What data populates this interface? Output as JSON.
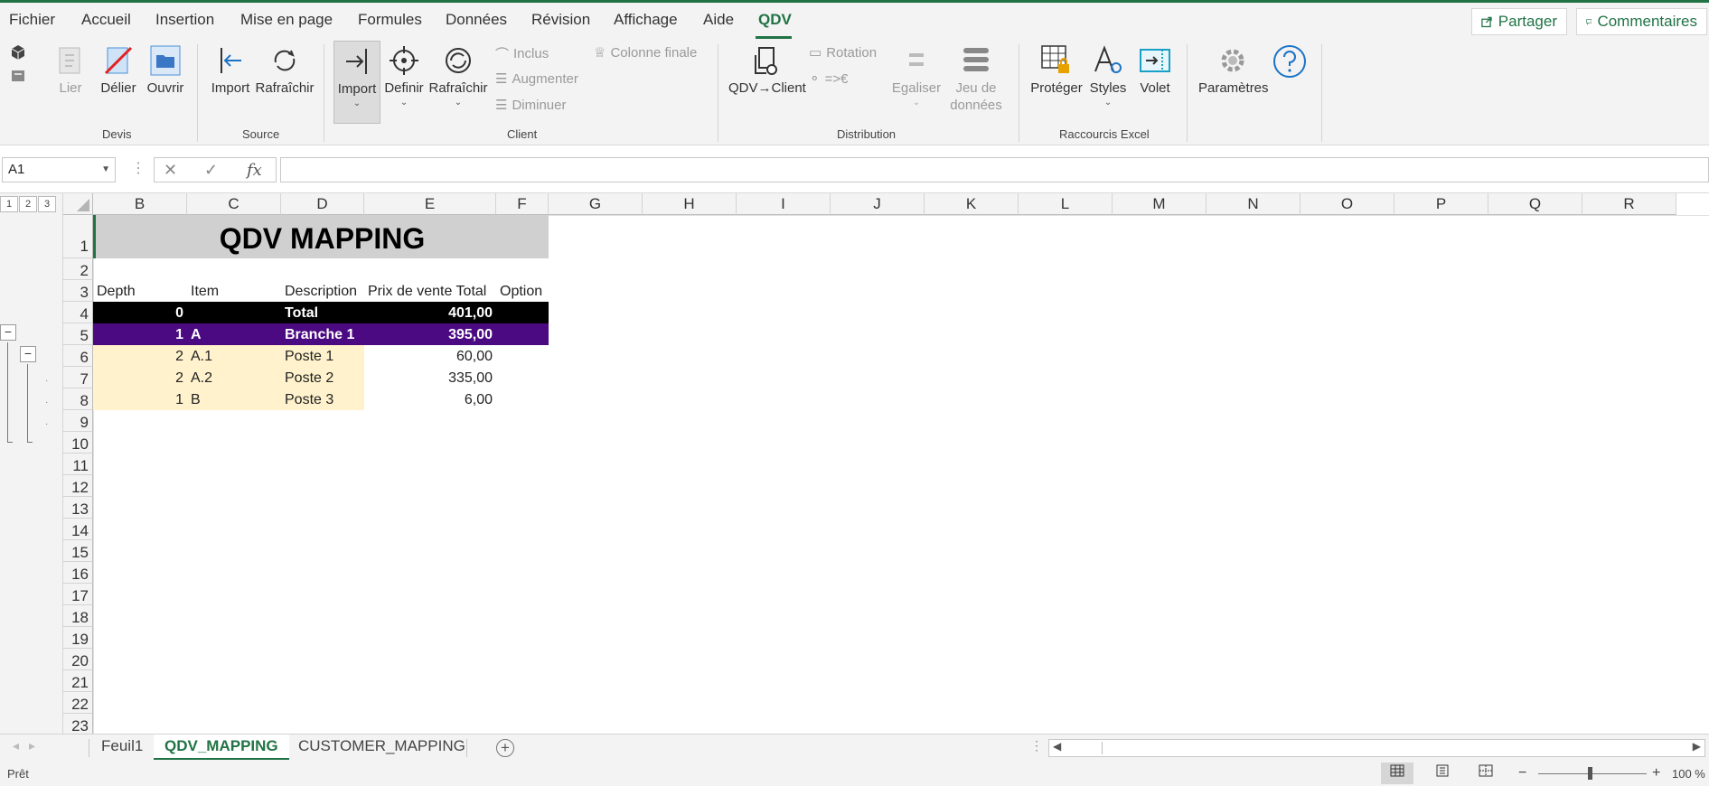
{
  "menu": {
    "items": [
      "Fichier",
      "Accueil",
      "Insertion",
      "Mise en page",
      "Formules",
      "Données",
      "Révision",
      "Affichage",
      "Aide",
      "QDV"
    ],
    "active": "QDV",
    "share_label": "Partager",
    "comments_label": "Commentaires"
  },
  "ribbon": {
    "groups": {
      "devis": {
        "label": "Devis",
        "lier": "Lier",
        "delier": "Délier",
        "ouvrir": "Ouvrir"
      },
      "source": {
        "label": "Source",
        "import": "Import",
        "rafraichir": "Rafraîchir"
      },
      "client": {
        "label": "Client",
        "import": "Import",
        "definir": "Definir",
        "rafraichir": "Rafraîchir",
        "inclus": "Inclus",
        "augmenter": "Augmenter",
        "diminuer": "Diminuer",
        "colonne_finale": "Colonne finale"
      },
      "distribution": {
        "label": "Distribution",
        "qdv_client": "QDV→Client",
        "rotation": "Rotation",
        "euro": "=>€",
        "egaliser": "Egaliser",
        "jeu_line1": "Jeu de",
        "jeu_line2": "données"
      },
      "raccourcis": {
        "label": "Raccourcis Excel",
        "proteger": "Protéger",
        "styles": "Styles",
        "volet": "Volet"
      },
      "parametres": {
        "label": "Paramètres"
      }
    },
    "help_icon": "question-circle-icon"
  },
  "formula_bar": {
    "name_box": "A1",
    "fx": "fx",
    "formula": ""
  },
  "outline": {
    "levels": [
      "1",
      "2",
      "3"
    ]
  },
  "columns": [
    "B",
    "C",
    "D",
    "E",
    "F",
    "G",
    "H",
    "I",
    "J",
    "K",
    "L",
    "M",
    "N",
    "O",
    "P",
    "Q",
    "R"
  ],
  "rows": [
    "1",
    "2",
    "3",
    "4",
    "5",
    "6",
    "7",
    "8",
    "9",
    "10",
    "11",
    "12",
    "13",
    "14",
    "15",
    "16",
    "17",
    "18",
    "19",
    "20",
    "21",
    "22",
    "23"
  ],
  "sheet": {
    "title": "QDV MAPPING",
    "headers": {
      "depth": "Depth",
      "item": "Item",
      "description": "Description",
      "prix": "Prix de vente Total",
      "option": "Option"
    },
    "data_rows": [
      {
        "depth": "0",
        "item": "",
        "description": "Total",
        "prix": "401,00",
        "style": "total"
      },
      {
        "depth": "1",
        "item": "A",
        "description": "Branche 1",
        "prix": "395,00",
        "style": "branch"
      },
      {
        "depth": "2",
        "item": "A.1",
        "description": "Poste 1",
        "prix": "60,00",
        "style": "poste"
      },
      {
        "depth": "2",
        "item": "A.2",
        "description": "Poste 2",
        "prix": "335,00",
        "style": "poste"
      },
      {
        "depth": "1",
        "item": "B",
        "description": "Poste 3",
        "prix": "6,00",
        "style": "poste"
      }
    ]
  },
  "tabs": {
    "items": [
      "Feuil1",
      "QDV_MAPPING",
      "CUSTOMER_MAPPING"
    ],
    "active": "QDV_MAPPING"
  },
  "status": {
    "ready": "Prêt",
    "zoom_minus": "−",
    "zoom_plus": "+",
    "zoom": "100 %"
  },
  "colors": {
    "accent": "#217346",
    "total_bg": "#000000",
    "branch_bg": "#4b0a82",
    "poste_bg": "#fff2cc",
    "title_bg": "#d0d0d0"
  }
}
